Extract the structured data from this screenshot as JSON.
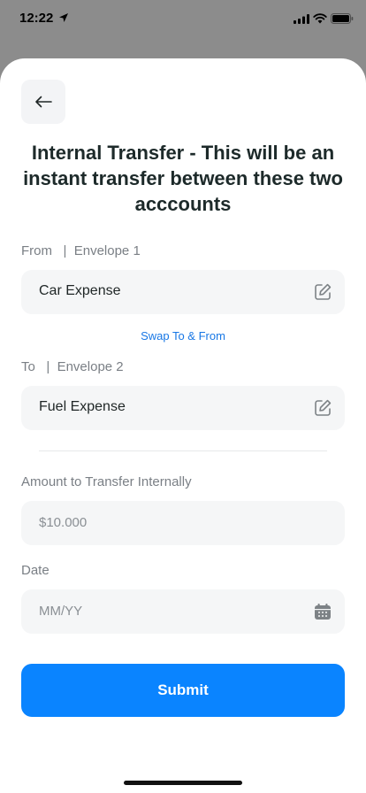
{
  "status_bar": {
    "time": "12:22"
  },
  "header": {
    "title": "Internal Transfer - This will be an instant transfer between these two acccounts"
  },
  "from": {
    "label": "From   |  Envelope 1",
    "value": "Car Expense"
  },
  "swap_link": "Swap To & From",
  "to": {
    "label": "To   |  Envelope 2",
    "value": "Fuel Expense"
  },
  "amount": {
    "label": "Amount to Transfer Internally",
    "placeholder": "$10.000"
  },
  "date": {
    "label": "Date",
    "placeholder": "MM/YY"
  },
  "submit_label": "Submit",
  "icons": {
    "back": "arrow-left-icon",
    "edit": "edit-icon",
    "calendar": "calendar-icon"
  },
  "colors": {
    "accent": "#0a84ff",
    "link": "#1877e5",
    "field_bg": "#f5f6f7"
  }
}
